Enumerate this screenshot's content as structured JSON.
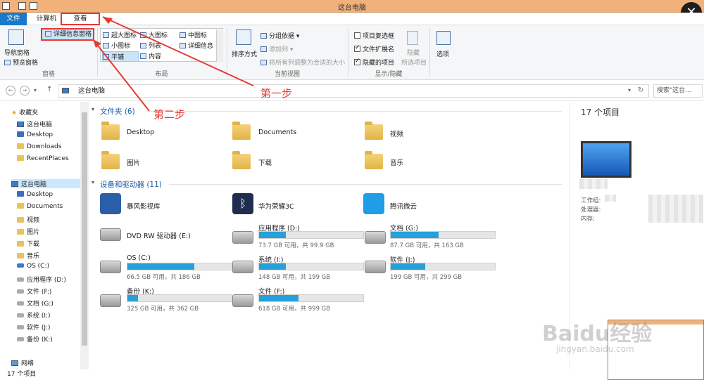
{
  "window": {
    "title": "这台电脑"
  },
  "tabs": {
    "file": "文件",
    "computer": "计算机",
    "view": "查看"
  },
  "ribbon": {
    "panes": {
      "nav_pane": "导航窗格",
      "preview_pane": "预览窗格",
      "details_pane": "详细信息窗格",
      "group": "窗格"
    },
    "layout": {
      "extra_large": "超大图标",
      "large": "大图标",
      "medium": "中图标",
      "small": "小图标",
      "list": "列表",
      "details": "详细信息",
      "tiles": "平铺",
      "content": "内容",
      "group": "布局"
    },
    "current_view": {
      "sort_by": "排序方式",
      "group_by": "分组依据",
      "add_columns": "添加列",
      "fit_columns": "将所有列调整为合适的大小",
      "group": "当前视图"
    },
    "show_hide": {
      "item_checkboxes": "项目复选框",
      "file_extensions": "文件扩展名",
      "hidden_items": "隐藏的项目",
      "hide": "隐藏",
      "selected_items": "所选项目",
      "group": "显示/隐藏"
    },
    "options": "选项"
  },
  "address": {
    "path": "这台电脑",
    "search_placeholder": "搜索\"这台..."
  },
  "nav": {
    "favorites": "收藏夹",
    "fav_items": [
      "这台电脑",
      "Desktop",
      "Downloads",
      "RecentPlaces"
    ],
    "this_pc": "这台电脑",
    "pc_items": [
      "Desktop",
      "Documents",
      "视频",
      "图片",
      "下载",
      "音乐",
      "OS (C:)",
      "应用程序 (D:)",
      "文件 (F:)",
      "文档 (G:)",
      "系统 (I:)",
      "软件 (J:)",
      "备份 (K:)"
    ],
    "network": "网络"
  },
  "main": {
    "folders_header": "文件夹 (6)",
    "folders": [
      "Desktop",
      "Documents",
      "视频",
      "图片",
      "下载",
      "音乐"
    ],
    "devices_header": "设备和驱动器 (11)",
    "apps": [
      "暴风影视库",
      "华为荣耀3C",
      "腾讯微云"
    ],
    "drives": [
      {
        "name": "DVD RW 驱动器 (E:)"
      },
      {
        "name": "应用程序 (D:)",
        "cap": "73.7 GB 可用，共 99.9 GB",
        "used": 0.26
      },
      {
        "name": "文档 (G:)",
        "cap": "87.7 GB 可用，共 163 GB",
        "used": 0.46
      },
      {
        "name": "OS (C:)",
        "cap": "66.5 GB 可用，共 186 GB",
        "used": 0.64
      },
      {
        "name": "系统 (I:)",
        "cap": "148 GB 可用，共 199 GB",
        "used": 0.26
      },
      {
        "name": "软件 (J:)",
        "cap": "199 GB 可用，共 299 GB",
        "used": 0.33
      },
      {
        "name": "备份 (K:)",
        "cap": "325 GB 可用，共 362 GB",
        "used": 0.1
      },
      {
        "name": "文件 (F:)",
        "cap": "618 GB 可用，共 999 GB",
        "used": 0.38
      }
    ]
  },
  "details": {
    "count": "17 个项目",
    "workgroup": "工作组:",
    "processor": "处理器:",
    "memory": "内存:"
  },
  "status": {
    "count": "17 个项目"
  },
  "annotations": {
    "step1": "第一步",
    "step2": "第二步"
  },
  "watermark": {
    "brand": "Baidu经验",
    "url": "jingyan.baidu.com"
  },
  "colors": {
    "accent": "#1979ca",
    "annotation": "#e53935",
    "drive_fill": "#26a0da"
  }
}
